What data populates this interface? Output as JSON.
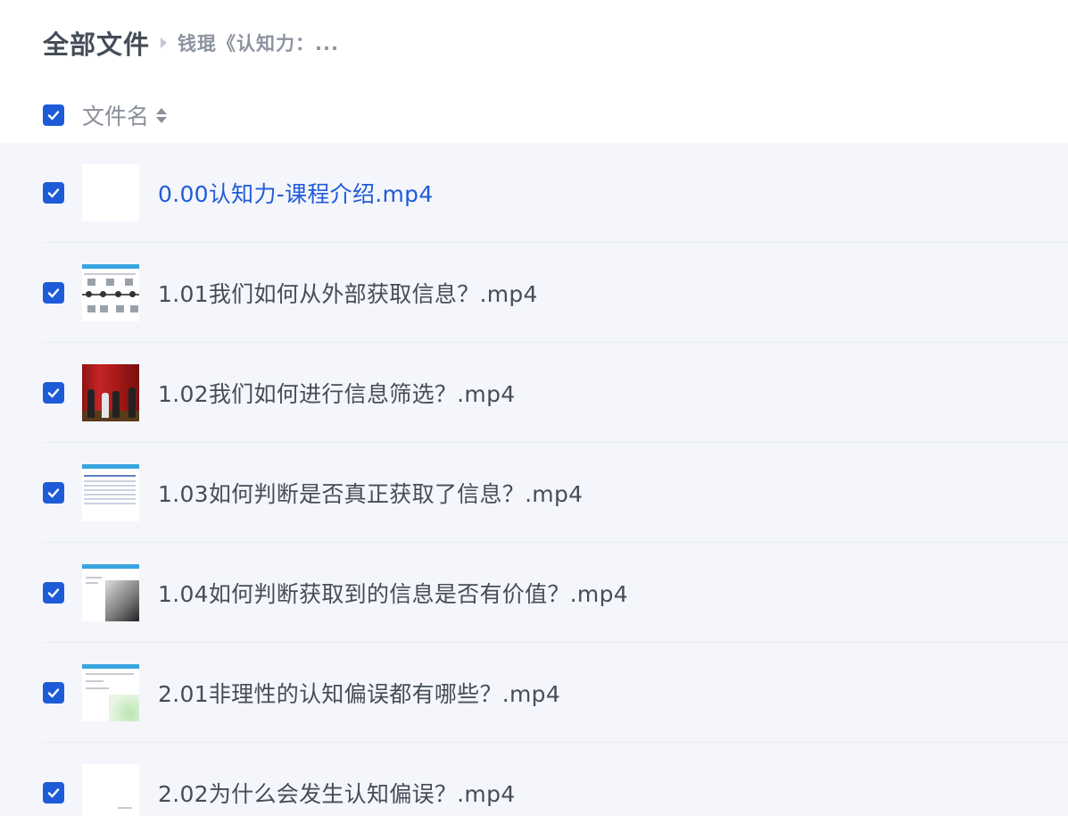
{
  "breadcrumb": {
    "root": "全部文件",
    "current": "钱琨《认知力：..."
  },
  "header": {
    "column_title": "文件名"
  },
  "files": [
    {
      "name": "0.00认知力-课程介绍.mp4",
      "checked": true,
      "link": true
    },
    {
      "name": "1.01我们如何从外部获取信息？.mp4",
      "checked": true
    },
    {
      "name": "1.02我们如何进行信息筛选？.mp4",
      "checked": true
    },
    {
      "name": "1.03如何判断是否真正获取了信息？.mp4",
      "checked": true
    },
    {
      "name": "1.04如何判断获取到的信息是否有价值？.mp4",
      "checked": true
    },
    {
      "name": "2.01非理性的认知偏误都有哪些？.mp4",
      "checked": true
    },
    {
      "name": "2.02为什么会发生认知偏误？.mp4",
      "checked": true
    }
  ],
  "colors": {
    "accent": "#1e5bd8",
    "list_background": "#f4f6fb"
  }
}
